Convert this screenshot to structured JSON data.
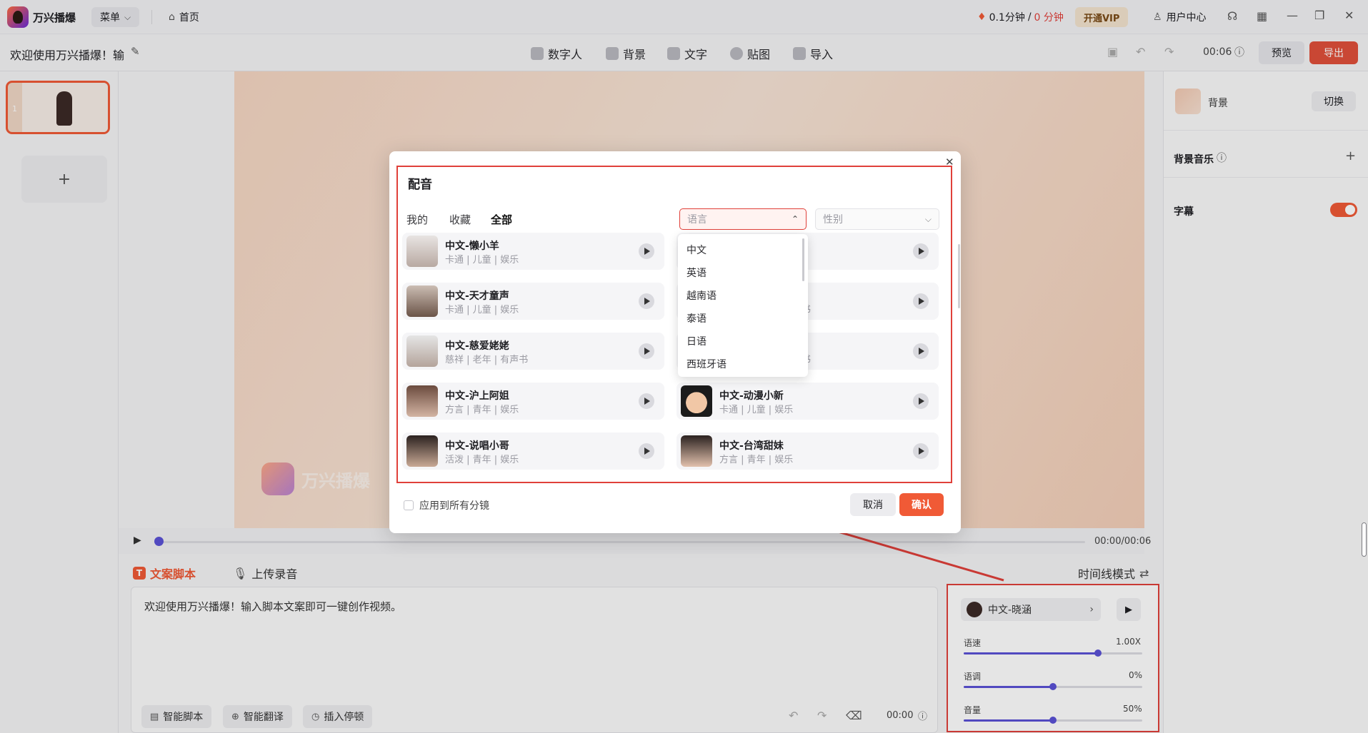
{
  "titlebar": {
    "app_name": "万兴播爆",
    "menu": "菜单",
    "home": "首页",
    "minutes_used": "0.1分钟",
    "separator": "/",
    "minutes_left": "0 分钟",
    "vip": "开通VIP",
    "user_center": "用户中心"
  },
  "toolbar": {
    "project_title": "欢迎使用万兴播爆！输",
    "tools": [
      "数字人",
      "背景",
      "文字",
      "贴图",
      "导入"
    ],
    "time": "00:06",
    "preview": "预览",
    "export": "导出"
  },
  "scenes": {
    "index": "1"
  },
  "right_panel": {
    "background": "背景",
    "switch": "切换",
    "bg_music": "背景音乐",
    "subtitle": "字幕"
  },
  "timeline": {
    "time": "00:00/00:06"
  },
  "script": {
    "tab_script": "文案脚本",
    "tab_upload": "上传录音",
    "mode": "时间线模式",
    "text": "欢迎使用万兴播爆！输入脚本文案即可一键创作视频。",
    "smart_script": "智能脚本",
    "smart_translate": "智能翻译",
    "insert_pause": "插入停顿",
    "time": "00:00"
  },
  "voice_panel": {
    "voice": "中文-晓涵",
    "speed_label": "语速",
    "speed_value": "1.00X",
    "speed_level": 0.75,
    "pitch_label": "语调",
    "pitch_value": "0%",
    "pitch_level": 0.5,
    "volume_label": "音量",
    "volume_value": "50%",
    "volume_level": 0.5
  },
  "watermark": "万兴播爆",
  "modal": {
    "title": "配音",
    "tabs": [
      "我的",
      "收藏",
      "全部"
    ],
    "language_placeholder": "语言",
    "gender_placeholder": "性别",
    "dropdown": [
      "中文",
      "英语",
      "越南语",
      "泰语",
      "日语",
      "西班牙语"
    ],
    "apply_all": "应用到所有分镜",
    "cancel": "取消",
    "confirm": "确认",
    "voices_left": [
      {
        "name": "中文-懒小羊",
        "tags": "卡通 | 儿童 | 娱乐"
      },
      {
        "name": "中文-天才童声",
        "tags": "卡通 | 儿童 | 娱乐"
      },
      {
        "name": "中文-慈爱姥姥",
        "tags": "慈祥 | 老年 | 有声书"
      },
      {
        "name": "中文-沪上阿姐",
        "tags": "方言 | 青年 | 娱乐"
      },
      {
        "name": "中文-说唱小哥",
        "tags": "活泼 | 青年 | 娱乐"
      }
    ],
    "voices_right": [
      {
        "name": "",
        "tags": ""
      },
      {
        "name": "",
        "tags": "书"
      },
      {
        "name": "",
        "tags": "书"
      },
      {
        "name": "中文-动漫小新",
        "tags": "卡通 | 儿童 | 娱乐"
      },
      {
        "name": "中文-台湾甜妹",
        "tags": "方言 | 青年 | 娱乐"
      }
    ]
  }
}
